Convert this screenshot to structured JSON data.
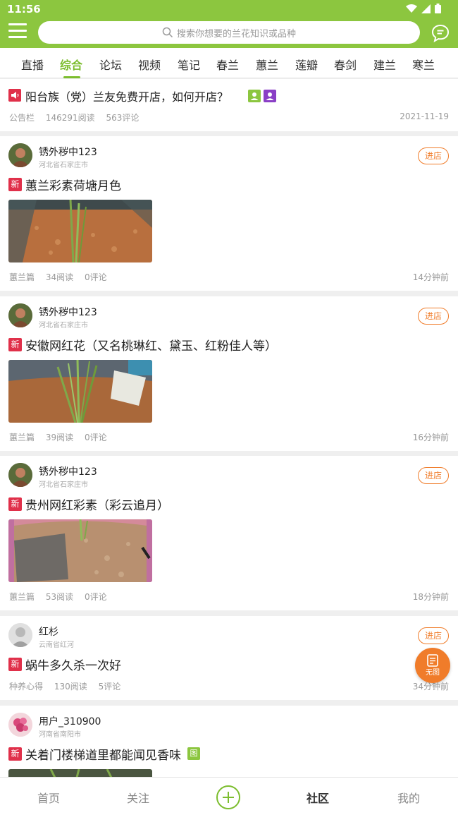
{
  "status_bar": {
    "time": "11:56"
  },
  "search": {
    "placeholder": "搜索你想要的兰花知识或品种"
  },
  "tabs": [
    {
      "label": "直播",
      "active": false
    },
    {
      "label": "综合",
      "active": true
    },
    {
      "label": "论坛",
      "active": false
    },
    {
      "label": "视频",
      "active": false
    },
    {
      "label": "笔记",
      "active": false
    },
    {
      "label": "春兰",
      "active": false
    },
    {
      "label": "蕙兰",
      "active": false
    },
    {
      "label": "莲瓣",
      "active": false
    },
    {
      "label": "春剑",
      "active": false
    },
    {
      "label": "建兰",
      "active": false
    },
    {
      "label": "寒兰",
      "active": false
    }
  ],
  "notice": {
    "title": "阳台族（党）兰友免费开店，如何开店？",
    "category": "公告栏",
    "reads": "146291阅读",
    "comments": "563评论",
    "date": "2021-11-19"
  },
  "posts": [
    {
      "user": "锈外秽中123",
      "location": "河北省石家庄市",
      "shop_label": "进店",
      "badge": "新",
      "title": "蕙兰彩素荷塘月色",
      "category": "蕙兰篇",
      "reads": "34阅读",
      "comments": "0评论",
      "time": "14分钟前"
    },
    {
      "user": "锈外秽中123",
      "location": "河北省石家庄市",
      "shop_label": "进店",
      "badge": "新",
      "title": "安徽网红花（又名桃琳红、黛玉、红粉佳人等）",
      "category": "蕙兰篇",
      "reads": "39阅读",
      "comments": "0评论",
      "time": "16分钟前"
    },
    {
      "user": "锈外秽中123",
      "location": "河北省石家庄市",
      "shop_label": "进店",
      "badge": "新",
      "title": "贵州网红彩素（彩云追月）",
      "category": "蕙兰篇",
      "reads": "53阅读",
      "comments": "0评论",
      "time": "18分钟前"
    },
    {
      "user": "红杉",
      "location": "云南省红河",
      "shop_label": "进店",
      "badge": "新",
      "title": "蜗牛多久杀一次好",
      "category": "种养心得",
      "reads": "130阅读",
      "comments": "5评论",
      "time": "34分钟前"
    },
    {
      "user": "用户_310900",
      "location": "河南省南阳市",
      "badge": "新",
      "title": "关着门楼梯道里都能闻见香味",
      "image_tag": "图"
    }
  ],
  "float_button": {
    "label": "无图"
  },
  "bottom_nav": {
    "home": "首页",
    "follow": "关注",
    "community": "社区",
    "mine": "我的"
  },
  "colors": {
    "brand_green": "#8cc63f",
    "accent_orange": "#f07c2a",
    "badge_red": "#e0304a"
  }
}
